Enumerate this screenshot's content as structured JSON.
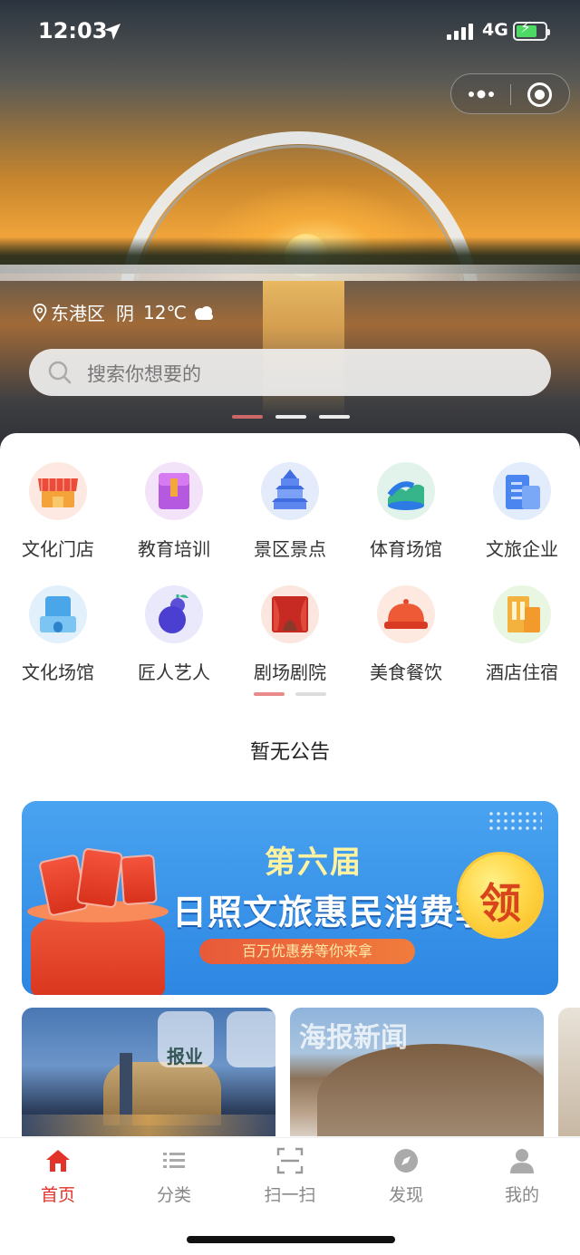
{
  "status_bar": {
    "time": "12:03",
    "network": "4G"
  },
  "hero": {
    "weather": {
      "location": "东港区",
      "condition": "阴",
      "temperature": "12℃"
    },
    "search_placeholder": "搜索你想要的",
    "carousel_total": 3,
    "carousel_active": 0
  },
  "categories": [
    {
      "label": "文化门店",
      "icon": "storefront-icon"
    },
    {
      "label": "教育培训",
      "icon": "book-icon"
    },
    {
      "label": "景区景点",
      "icon": "temple-icon"
    },
    {
      "label": "体育场馆",
      "icon": "stadium-icon"
    },
    {
      "label": "文旅企业",
      "icon": "office-building-icon"
    },
    {
      "label": "文化场馆",
      "icon": "venue-icon"
    },
    {
      "label": "匠人艺人",
      "icon": "gourd-icon"
    },
    {
      "label": "剧场剧院",
      "icon": "theater-curtain-icon"
    },
    {
      "label": "美食餐饮",
      "icon": "food-cloche-icon"
    },
    {
      "label": "酒店住宿",
      "icon": "hotel-icon"
    }
  ],
  "category_pages": {
    "total": 2,
    "active": 0
  },
  "notice": "暂无公告",
  "banner": {
    "line1": "第六届",
    "line2": "日照文旅惠民消费季",
    "line3": "百万优惠券等你来拿",
    "badge": "领"
  },
  "photo_watermarks": {
    "left": "报业",
    "right": "海报新闻"
  },
  "tabbar": [
    {
      "label": "首页",
      "icon": "home-icon",
      "active": true
    },
    {
      "label": "分类",
      "icon": "list-icon",
      "active": false
    },
    {
      "label": "扫一扫",
      "icon": "scan-icon",
      "active": false
    },
    {
      "label": "发现",
      "icon": "compass-icon",
      "active": false
    },
    {
      "label": "我的",
      "icon": "person-icon",
      "active": false
    }
  ],
  "colors": {
    "accent": "#e2322a",
    "banner_blue": "#2d86e2",
    "coin_gold": "#ffd84a"
  }
}
